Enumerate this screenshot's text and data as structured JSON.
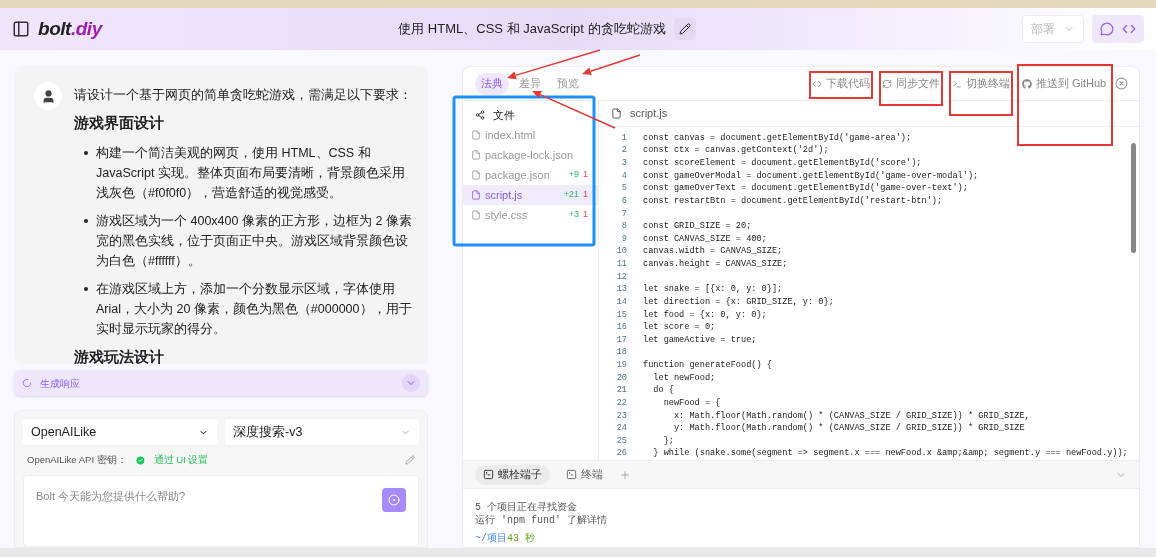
{
  "header": {
    "logo_main": "bolt",
    "logo_accent": ".diy",
    "title": "使用 HTML、CSS 和 JavaScript 的贪吃蛇游戏",
    "deploy": {
      "label": "部署",
      "disabled": true
    }
  },
  "chat": {
    "user_message": "请设计一个基于网页的简单贪吃蛇游戏，需满足以下要求：",
    "blocks": [
      {
        "kind": "heading",
        "text": "游戏界面设计"
      },
      {
        "kind": "bullet",
        "text": "构建一个简洁美观的网页，使用 HTML、CSS 和 JavaScript 实现。整体页面布局要清晰，背景颜色采用浅灰色（#f0f0f0），营造舒适的视觉感受。"
      },
      {
        "kind": "bullet",
        "text": "游戏区域为一个 400x400 像素的正方形，边框为 2 像素宽的黑色实线，位于页面正中央。游戏区域背景颜色设为白色（#ffffff）。"
      },
      {
        "kind": "bullet",
        "text": "在游戏区域上方，添加一个分数显示区域，字体使用 Arial，大小为 20 像素，颜色为黑色（#000000），用于实时显示玩家的得分。"
      },
      {
        "kind": "heading",
        "text": "游戏玩法设计"
      }
    ],
    "status": "生成响应",
    "provider": "OpenAILike",
    "model": "深度搜索-v3",
    "api_key_label": "OpenAILike API 密钥：",
    "api_key_status": "通过 UI 设置",
    "prompt_placeholder": "Bolt 今天能为您提供什么帮助?"
  },
  "workbench": {
    "tabs": [
      {
        "label": "法典",
        "selected": true
      },
      {
        "label": "差异",
        "selected": false
      },
      {
        "label": "预览",
        "selected": false
      }
    ],
    "actions": [
      {
        "kind": "download",
        "label": "下载代码"
      },
      {
        "kind": "sync",
        "label": "同步文件"
      },
      {
        "kind": "terminal",
        "label": "切换终端"
      },
      {
        "kind": "github",
        "label": "推送到 GitHub"
      }
    ],
    "files_title": "文件",
    "files": [
      {
        "name": "index.html",
        "selected": false
      },
      {
        "name": "package-lock.json",
        "selected": false
      },
      {
        "name": "package.json",
        "additions": "+9",
        "deletions": "1",
        "selected": false
      },
      {
        "name": "script.js",
        "additions": "+21",
        "deletions": "1",
        "selected": true
      },
      {
        "name": "style.css",
        "additions": "+3",
        "deletions": "1",
        "selected": false
      }
    ],
    "editor_file": "script.js",
    "code": [
      {
        "number": "1",
        "code": "const canvas = document.getElementById('game-area');"
      },
      {
        "number": "2",
        "code": "const ctx = canvas.getContext('2d');"
      },
      {
        "number": "3",
        "code": "const scoreElement = document.getElementById('score');"
      },
      {
        "number": "4",
        "code": "const gameOverModal = document.getElementById('game-over-modal');"
      },
      {
        "number": "5",
        "code": "const gameOverText = document.getElementById('game-over-text');"
      },
      {
        "number": "6",
        "code": "const restartBtn = document.getElementById('restart-btn');"
      },
      {
        "number": "7"
      },
      {
        "number": "8",
        "code": "const GRID_SIZE = 20;"
      },
      {
        "number": "9",
        "code": "const CANVAS_SIZE = 400;"
      },
      {
        "number": "10",
        "code": "canvas.width = CANVAS_SIZE;"
      },
      {
        "number": "11",
        "code": "canvas.height = CANVAS_SIZE;"
      },
      {
        "number": "12"
      },
      {
        "number": "13",
        "code": "let snake = [{x: 0, y: 0}];"
      },
      {
        "number": "14",
        "code": "let direction = {x: GRID_SIZE, y: 0};"
      },
      {
        "number": "15",
        "code": "let food = {x: 0, y: 0};"
      },
      {
        "number": "16",
        "code": "let score = 0;"
      },
      {
        "number": "17",
        "code": "let gameActive = true;"
      },
      {
        "number": "18"
      },
      {
        "number": "19",
        "code": "function generateFood() {"
      },
      {
        "number": "20",
        "code": "  let newFood;"
      },
      {
        "number": "21",
        "code": "  do {"
      },
      {
        "number": "22",
        "code": "    newFood = {"
      },
      {
        "number": "23",
        "code": "      x: Math.floor(Math.random() * (CANVAS_SIZE / GRID_SIZE)) * GRID_SIZE,"
      },
      {
        "number": "24",
        "code": "      y: Math.floor(Math.random() * (CANVAS_SIZE / GRID_SIZE)) * GRID_SIZE"
      },
      {
        "number": "25",
        "code": "    };"
      },
      {
        "number": "26",
        "code": "  } while (snake.some(segment => segment.x === newFood.x &amp;&amp; segment.y === newFood.y));"
      }
    ],
    "terminal_tabs": [
      {
        "label": "螺栓端子",
        "selected": true
      },
      {
        "label": "终端",
        "selected": false
      }
    ],
    "terminal_lines": [
      "5 个项目正在寻找资金",
      "运行 'npm fund' 了解详情"
    ],
    "prompt_path": "~/项目",
    "prompt_time": "43 秒"
  }
}
